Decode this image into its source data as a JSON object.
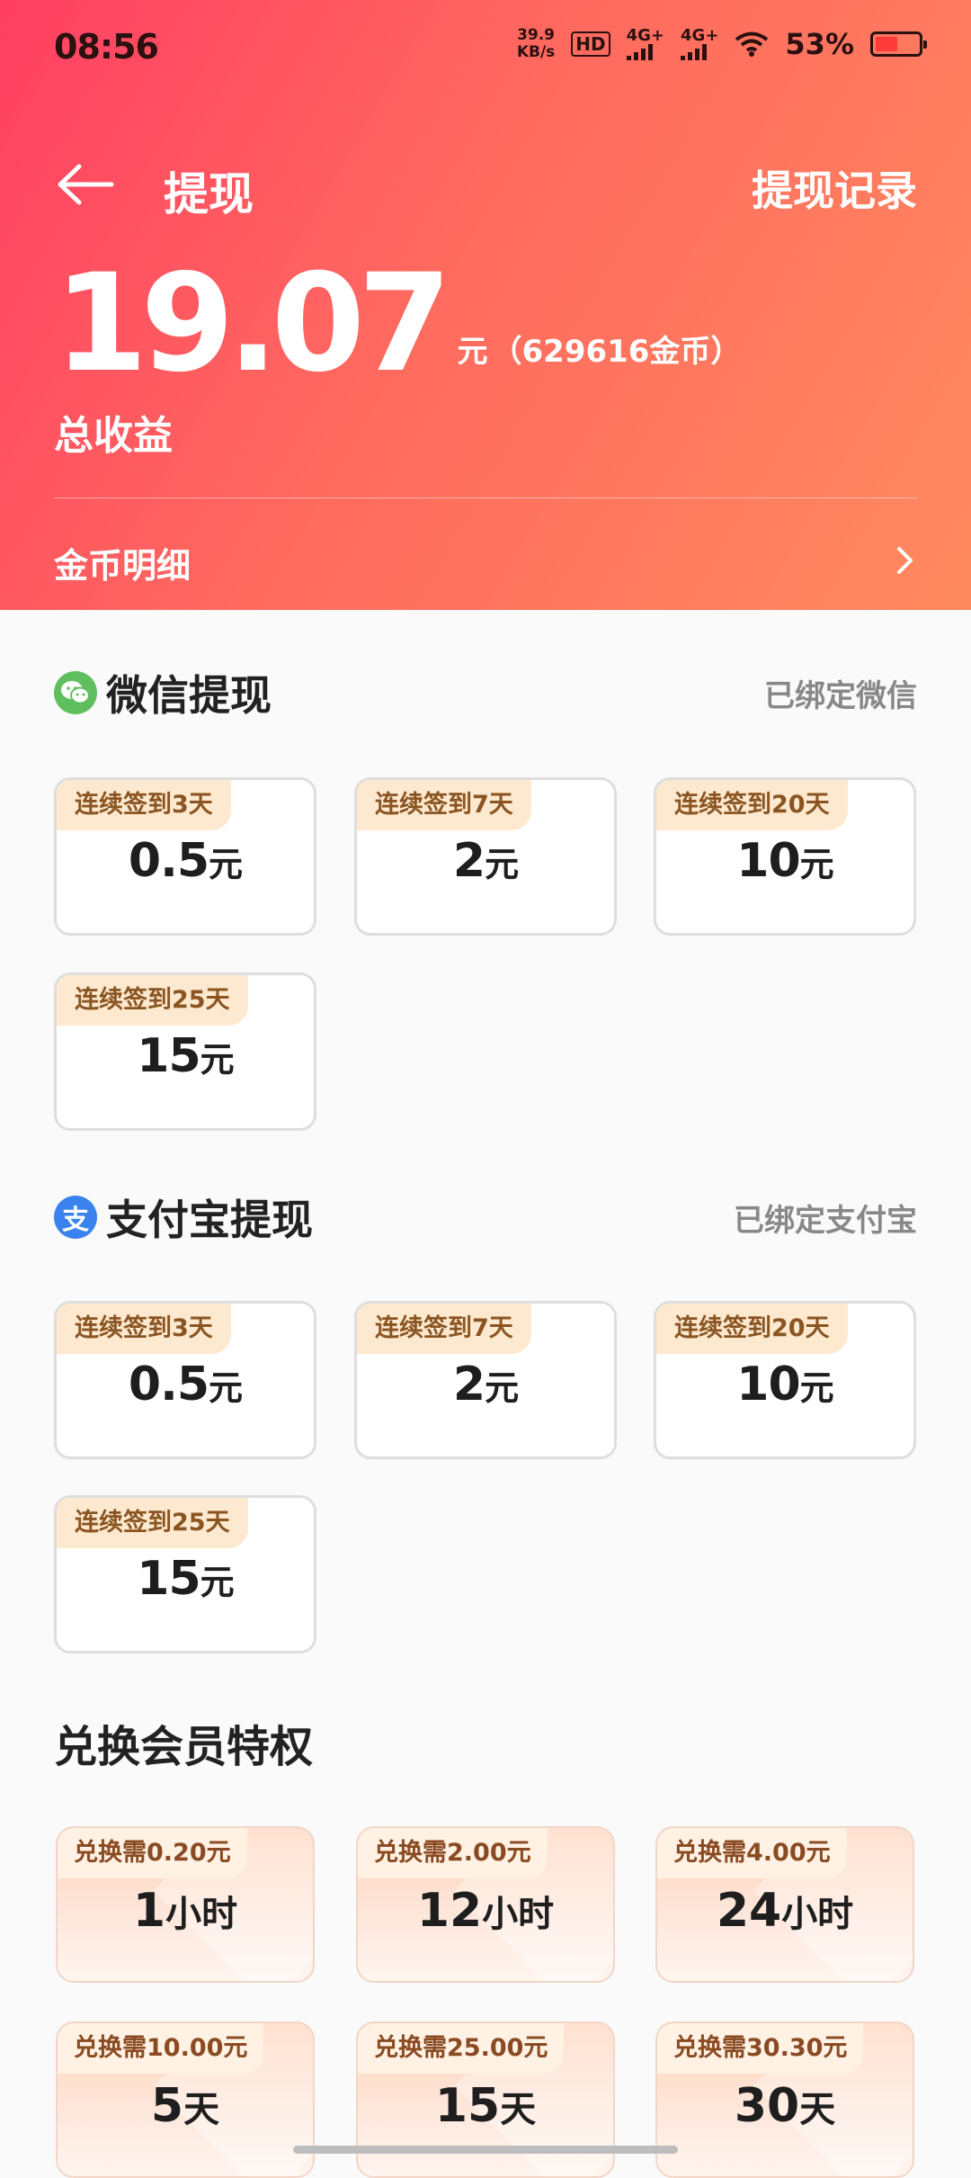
{
  "status_bar": {
    "time": "08:56",
    "net_speed": "39.9",
    "net_unit": "KB/s",
    "hd": "HD",
    "sim1": "4G+",
    "sim2": "4G+",
    "battery_pct": "53%",
    "battery_level": 0.53
  },
  "header": {
    "title": "提现",
    "record_link": "提现记录",
    "amount": "19.07",
    "unit": "元",
    "coins": "（629616金币）",
    "total_label": "总收益",
    "coin_detail": "金币明细"
  },
  "wechat": {
    "title": "微信提现",
    "bound": "已绑定微信",
    "cards": [
      {
        "tag": "连续签到3天",
        "amount": "0.5",
        "unit": "元"
      },
      {
        "tag": "连续签到7天",
        "amount": "2",
        "unit": "元"
      },
      {
        "tag": "连续签到20天",
        "amount": "10",
        "unit": "元"
      },
      {
        "tag": "连续签到25天",
        "amount": "15",
        "unit": "元"
      }
    ]
  },
  "alipay": {
    "title": "支付宝提现",
    "bound": "已绑定支付宝",
    "icon_char": "支",
    "cards": [
      {
        "tag": "连续签到3天",
        "amount": "0.5",
        "unit": "元"
      },
      {
        "tag": "连续签到7天",
        "amount": "2",
        "unit": "元"
      },
      {
        "tag": "连续签到20天",
        "amount": "10",
        "unit": "元"
      },
      {
        "tag": "连续签到25天",
        "amount": "15",
        "unit": "元"
      }
    ]
  },
  "vip": {
    "title": "兑换会员特权",
    "cards": [
      {
        "tag": "兑换需0.20元",
        "amount": "1",
        "unit": "小时"
      },
      {
        "tag": "兑换需2.00元",
        "amount": "12",
        "unit": "小时"
      },
      {
        "tag": "兑换需4.00元",
        "amount": "24",
        "unit": "小时"
      },
      {
        "tag": "兑换需10.00元",
        "amount": "5",
        "unit": "天"
      },
      {
        "tag": "兑换需25.00元",
        "amount": "15",
        "unit": "天"
      },
      {
        "tag": "兑换需30.30元",
        "amount": "30",
        "unit": "天"
      }
    ]
  },
  "colors": {
    "header_start": "#ff3f63",
    "header_end": "#ff8a5f",
    "tag_bg": "#fde9cf",
    "tag_text": "#8a5522",
    "wechat_green": "#5fbf5f",
    "alipay_blue": "#3a82ee"
  }
}
